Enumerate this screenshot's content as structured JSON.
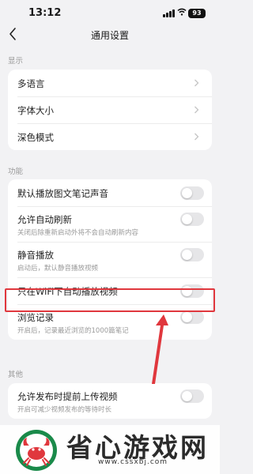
{
  "status_bar": {
    "time": "13:12",
    "battery": "93"
  },
  "nav": {
    "title": "通用设置"
  },
  "sections": {
    "display": "显示",
    "features": "功能",
    "other": "其他"
  },
  "display_items": [
    {
      "label": "多语言"
    },
    {
      "label": "字体大小"
    },
    {
      "label": "深色模式"
    }
  ],
  "feature_items": [
    {
      "label": "默认播放图文笔记声音",
      "enabled": false
    },
    {
      "label": "允许自动刷新",
      "sub": "关闭后除重新启动外将不会自动刷新内容",
      "enabled": false
    },
    {
      "label": "静音播放",
      "sub": "启动后，默认静音播放视频",
      "enabled": false
    },
    {
      "label": "只在WiFi下自动播放视频",
      "enabled": false
    },
    {
      "label": "浏览记录",
      "sub": "开启后，记录最近浏览的1000篇笔记",
      "enabled": false
    }
  ],
  "other_items": [
    {
      "label": "允许发布时提前上传视频",
      "sub": "开启可减少视频发布的等待时长",
      "enabled": false
    }
  ],
  "colors": {
    "highlight": "#e0373d",
    "background": "#f2f2f4",
    "toggle_off": "#e6e6e8"
  },
  "watermark": {
    "brand": "省心游戏网",
    "url": "www.cssxbj.com"
  }
}
